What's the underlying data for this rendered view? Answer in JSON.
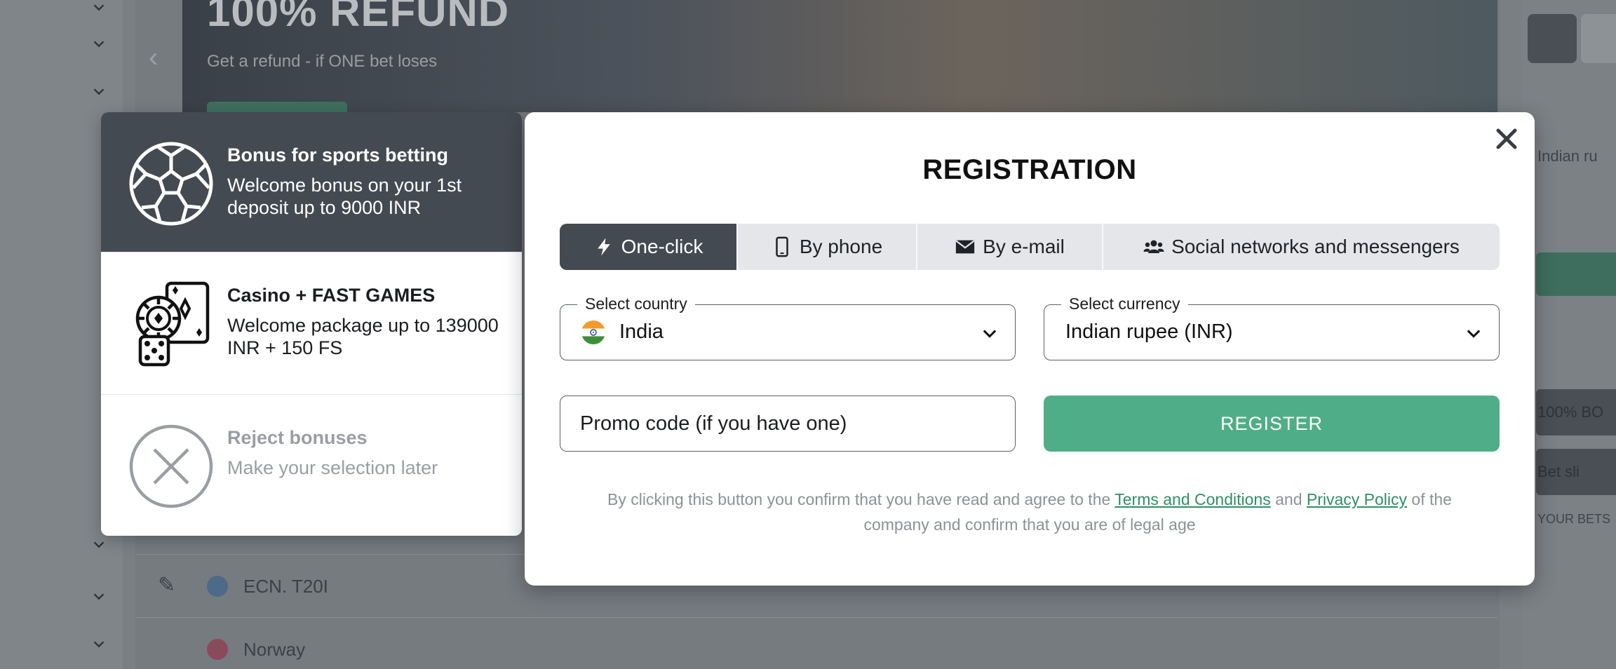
{
  "background": {
    "banner_title": "100% REFUND",
    "banner_subtitle": "Get a refund - if ONE bet loses",
    "rows": [
      {
        "name": "ECN. T20I"
      },
      {
        "name": "Norway"
      }
    ],
    "right_texts": [
      "Indian ru",
      "100% BO",
      "Bet sli",
      "YOUR BETS"
    ]
  },
  "bonus": {
    "items": [
      {
        "title": "Bonus for sports betting",
        "desc": "Welcome bonus on your 1st deposit up to 9000 INR",
        "icon": "soccer-ball-icon"
      },
      {
        "title": "Casino + FAST GAMES",
        "desc": "Welcome package up to 139000 INR + 150 FS",
        "icon": "casino-chips-cards-dice-icon"
      },
      {
        "title": "Reject bonuses",
        "desc": "Make your selection later",
        "icon": "reject-x-circle-icon"
      }
    ]
  },
  "registration": {
    "title": "REGISTRATION",
    "tabs": [
      {
        "label": "One-click",
        "icon": "lightning-icon",
        "active": true
      },
      {
        "label": "By phone",
        "icon": "phone-icon",
        "active": false
      },
      {
        "label": "By e-mail",
        "icon": "envelope-icon",
        "active": false
      },
      {
        "label": "Social networks and messengers",
        "icon": "users-icon",
        "active": false
      }
    ],
    "country": {
      "label": "Select country",
      "value": "India"
    },
    "currency": {
      "label": "Select currency",
      "value": "Indian rupee (INR)"
    },
    "promo": {
      "placeholder": "Promo code (if you have one)"
    },
    "register_label": "REGISTER",
    "legal": {
      "prefix": "By clicking this button you confirm that you have read and agree to the",
      "terms": "Terms and Conditions",
      "and": "and",
      "privacy": "Privacy Policy",
      "suffix": "of the company and confirm that you are of legal age"
    }
  },
  "colors": {
    "accent_green": "#4fae88",
    "dark_tab": "#444a51",
    "link_green": "#2e8f68"
  }
}
